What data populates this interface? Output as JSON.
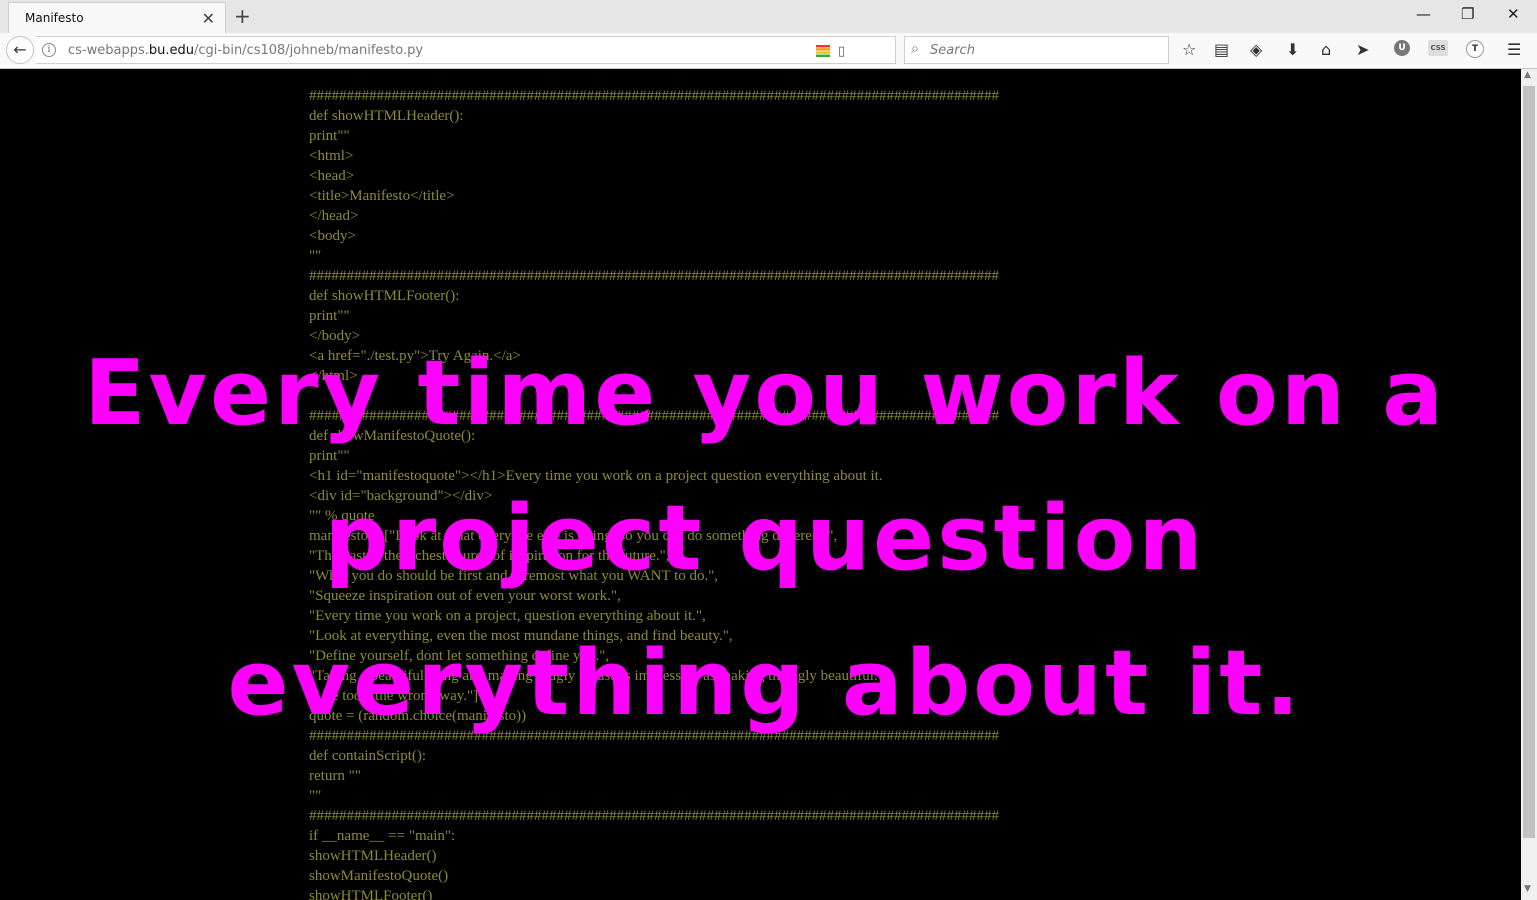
{
  "browser": {
    "tab_title": "Manifesto",
    "tab_close": "✕",
    "new_tab": "+",
    "window_controls": {
      "minimize": "—",
      "restore": "❐",
      "close": "✕"
    },
    "url_prefix": "cs-webapps.",
    "url_host": "bu.edu",
    "url_path": "/cgi-bin/cs108/johneb/manifesto.py",
    "search_placeholder": "Search",
    "icons": {
      "back": "←",
      "reload": "⟳",
      "info": "i",
      "reader": "▯",
      "search": "⌕",
      "bookmark": "☆",
      "library": "▤",
      "pocket": "◈",
      "download": "⬇",
      "home": "⌂",
      "send": "➤",
      "ublock": "U",
      "css": "CSS",
      "translate": "T",
      "menu": "☰"
    }
  },
  "code_lines": [
    "############################################################################################",
    "def showHTMLHeader():",
    "print\"\"",
    "<html>",
    "<head>",
    "<title>Manifesto</title>",
    "</head>",
    "<body>",
    "\"\"",
    "############################################################################################",
    "def showHTMLFooter():",
    "print\"\"",
    "</body>",
    "<a href=\"./test.py\">Try Again.</a>",
    "</html>",
    "",
    "############################################################################################",
    "def showManifestoQuote():",
    "print\"\"",
    "<h1 id=\"manifestoquote\"></h1>Every time you work on a project question everything about it.",
    "<div id=\"background\"></div>",
    "\"\" % quote",
    "manifesto = [\"Look at what everyone else is doing, so you can do something different.\",",
    "\"The past is the richest source of inspiration for the future.\",",
    "\"What you do should be first and foremost what you WANT to do.\",",
    "\"Squeeze inspiration out of even your worst work.\",",
    "\"Every time you work on a project, question everything about it.\",",
    "\"Look at everything, even the most mundane things, and find beauty.\",",
    "\"Define yourself, dont let something define you.\",",
    "\"Taking a beautiful thing and making it ugly is just as impressive as making the ugly beautiful.\",",
    "\"Use tools the wrong way.\"]",
    "quote = (random.choice(manifesto))",
    "############################################################################################",
    "def containScript():",
    "return \"\"",
    "\"\"",
    "############################################################################################",
    "if __name__ == \"main\":",
    "showHTMLHeader()",
    "showManifestoQuote()",
    "showHTMLFooter()"
  ],
  "quote_text": "Every time you work on a project question everything about it.",
  "colors": {
    "quote": "#ff00ff",
    "code": "#8b8b34",
    "background": "#000000"
  }
}
